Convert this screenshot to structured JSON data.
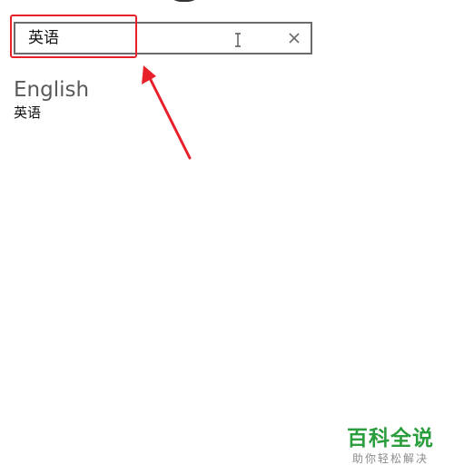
{
  "search": {
    "value": "英语",
    "placeholder": ""
  },
  "results": [
    {
      "title": "English",
      "subtitle": "英语"
    }
  ],
  "annotation": {
    "highlight_color": "#e8202a"
  },
  "watermark": {
    "title": "百科全说",
    "subtitle": "助你轻松解决",
    "color": "#2a9d3c"
  },
  "icons": {
    "clear": "close-icon",
    "cursor": "text-cursor-icon"
  }
}
